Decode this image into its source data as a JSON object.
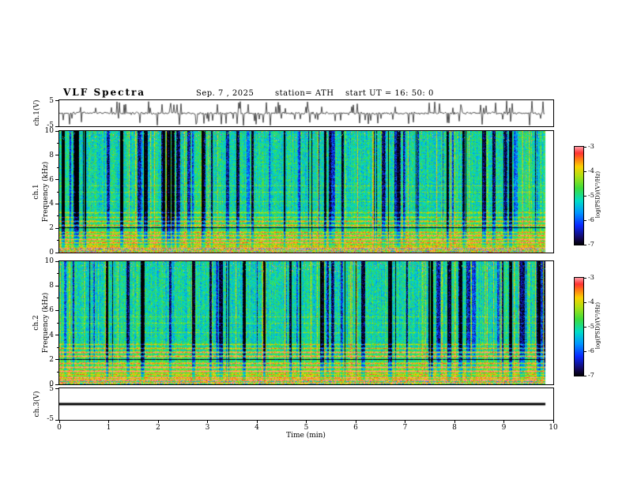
{
  "title": "VLF  Spectra",
  "header": {
    "date": "Sep. 7 , 2025",
    "station": "station= ATH",
    "start_ut": "start UT =  16: 50: 0"
  },
  "panels": {
    "ch1_wave": {
      "ylabel": "ch.1(V)",
      "ymax": "5",
      "ymin": "-5"
    },
    "ch1_spec": {
      "ylabel_line1": "ch.1",
      "ylabel_line2": "Frequency (kHz)",
      "yticks": [
        "10",
        "8",
        "6",
        "4",
        "2",
        "0"
      ]
    },
    "ch2_spec": {
      "ylabel_line1": "ch.2",
      "ylabel_line2": "Frequency (kHz)",
      "yticks": [
        "10",
        "8",
        "6",
        "4",
        "2",
        "0"
      ]
    },
    "ch3_wave": {
      "ylabel": "ch.3(V)",
      "ymax": "5",
      "ymin": "-5"
    }
  },
  "xaxis": {
    "label": "Time (min)",
    "ticks": [
      "0",
      "1",
      "2",
      "3",
      "4",
      "5",
      "6",
      "7",
      "8",
      "9",
      "10"
    ]
  },
  "colorbars": [
    {
      "label": "log(PSD)/(V²/Hz)",
      "ticks": [
        "-3",
        "-4",
        "-5",
        "-6",
        "-7"
      ]
    },
    {
      "label": "log(PSD)/(V²/Hz)",
      "ticks": [
        "-3",
        "-4",
        "-5",
        "-6",
        "-7"
      ]
    }
  ],
  "colors": {
    "background": "#ffffff",
    "axis": "#000000",
    "colormap_stops": [
      {
        "t": 0.0,
        "c": "#000000"
      },
      {
        "t": 0.07,
        "c": "#14085a"
      },
      {
        "t": 0.2,
        "c": "#0a28ff"
      },
      {
        "t": 0.33,
        "c": "#0096ff"
      },
      {
        "t": 0.45,
        "c": "#00dcc8"
      },
      {
        "t": 0.58,
        "c": "#3cdc3c"
      },
      {
        "t": 0.7,
        "c": "#aae114"
      },
      {
        "t": 0.8,
        "c": "#fad200"
      },
      {
        "t": 0.88,
        "c": "#ff7814"
      },
      {
        "t": 0.94,
        "c": "#ff3232"
      },
      {
        "t": 1.0,
        "c": "#ff96a0"
      }
    ]
  },
  "chart_data": [
    {
      "type": "line",
      "name": "ch.1 waveform",
      "ylabel": "ch.1(V)",
      "xlim": [
        0,
        10
      ],
      "ylim": [
        -5,
        5
      ],
      "x_units": "min",
      "data_end_min": 9.85,
      "description": "Noisy VLF channel-1 voltage: baseline fluctuating within about ±1 V with roughly 100 impulsive sferic spikes reaching ±2 to ±5 V, fairly uniformly distributed over 0–9.85 min."
    },
    {
      "type": "heatmap",
      "name": "ch.1 spectrogram",
      "xlabel": "Time (min)",
      "ylabel": "ch.1 Frequency (kHz)",
      "xlim": [
        0,
        10
      ],
      "ylim": [
        0,
        10
      ],
      "zlim": [
        -7,
        -3
      ],
      "zlabel": "log(PSD)/(V²/Hz)",
      "background_level": -5,
      "features": [
        "green/teal background near -5 log(PSD)",
        "dense vertical dark-blue low-PSD streaks strongest between 3 and 10 kHz (impulsive sferics)",
        "bright yellow/orange/red horizontal interference lines below about 3.5 kHz",
        "dark band near 2 kHz",
        "multicolored clutter band below 0.4 kHz",
        "scattered red high-PSD specks near 9–10 kHz"
      ]
    },
    {
      "type": "heatmap",
      "name": "ch.2 spectrogram",
      "xlabel": "Time (min)",
      "ylabel": "ch.2 Frequency (kHz)",
      "xlim": [
        0,
        10
      ],
      "ylim": [
        0,
        10
      ],
      "zlim": [
        -7,
        -3
      ],
      "zlabel": "log(PSD)/(V²/Hz)",
      "background_level": -5,
      "features": [
        "green/teal background near -5 log(PSD)",
        "dense vertical dark-blue low-PSD streaks strongest between 3 and 10 kHz",
        "bright yellow/orange/red horizontal interference lines below about 3.5 kHz",
        "multicolored clutter band below 0.4 kHz"
      ]
    },
    {
      "type": "line",
      "name": "ch.3 waveform",
      "ylabel": "ch.3(V)",
      "xlim": [
        0,
        10
      ],
      "ylim": [
        -5,
        5
      ],
      "data_end_min": 9.85,
      "values_constant": 0,
      "description": "Flat heavy black line at 0 V (channel inactive)."
    }
  ]
}
